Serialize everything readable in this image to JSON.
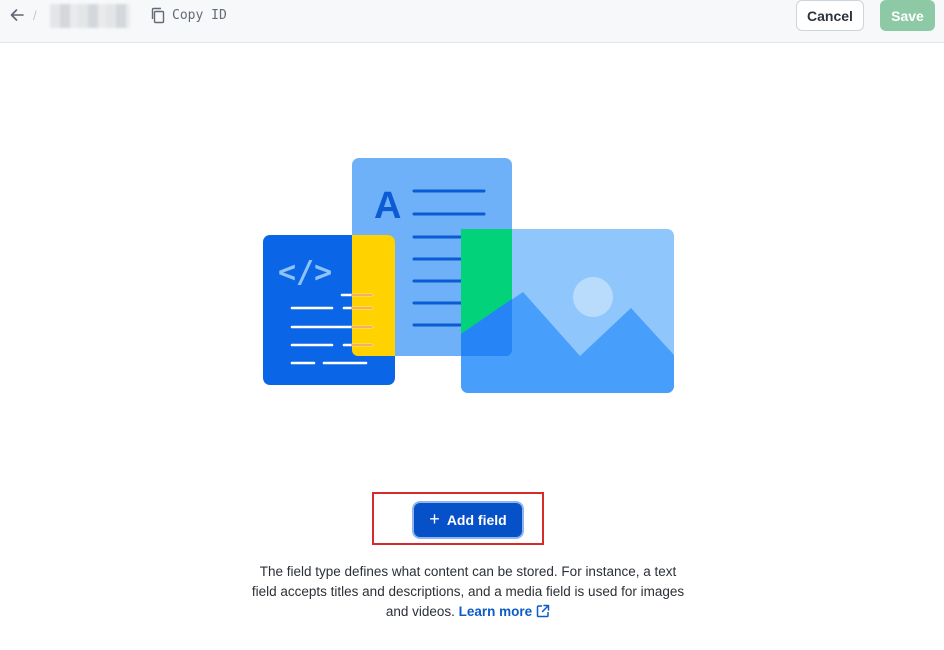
{
  "header": {
    "copy_id_label": "Copy ID",
    "cancel_label": "Cancel",
    "save_label": "Save"
  },
  "main": {
    "add_field_label": "Add field",
    "description_text": "The field type defines what content can be stored. For instance, a text field accepts titles and descriptions, and a media field is used for images and videos.",
    "learn_more_label": "Learn more"
  },
  "colors": {
    "primary_blue": "#0650c8",
    "save_green": "#8cc9a4",
    "highlight_red": "#d42b2b",
    "link_blue": "#0b5cc6"
  },
  "icons": {
    "back": "arrow-left-icon",
    "copy": "copy-icon",
    "plus": "plus-icon",
    "external_link": "external-link-icon"
  }
}
